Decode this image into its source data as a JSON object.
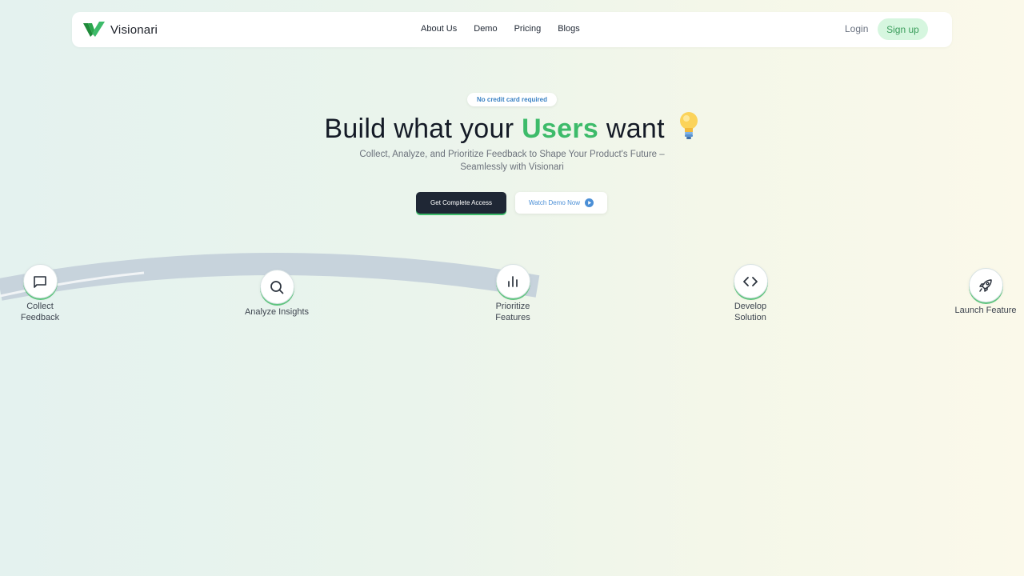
{
  "brand": {
    "name": "Visionari",
    "logo_icon": "visionari-logo",
    "accent_green": "#3dbb6a",
    "dark_button": "#1f2735"
  },
  "nav": {
    "links": [
      "About Us",
      "Demo",
      "Pricing",
      "Blogs"
    ],
    "login": "Login",
    "signup": "Sign up"
  },
  "hero": {
    "badge": "No credit card required",
    "headline_before": "Build what your",
    "headline_accent": "Users",
    "headline_after": "want",
    "headline_icon": "lightbulb-icon",
    "subtitle_line1": "Collect, Analyze, and Prioritize Feedback to Shape Your Product's Future –",
    "subtitle_line2": "Seamlessly with Visionari",
    "primary_cta": "Get Complete Access",
    "secondary_cta": "Watch Demo Now",
    "secondary_cta_icon": "play-icon"
  },
  "steps": [
    {
      "line1": "Collect",
      "line2": "Feedback",
      "icon": "message-icon"
    },
    {
      "line1": "Analyze Insights",
      "line2": "",
      "icon": "search-icon"
    },
    {
      "line1": "Prioritize",
      "line2": "Features",
      "icon": "bar-chart-icon"
    },
    {
      "line1": "Develop",
      "line2": "Solution",
      "icon": "code-icon"
    },
    {
      "line1": "Launch Feature",
      "line2": "",
      "icon": "rocket-icon"
    }
  ]
}
